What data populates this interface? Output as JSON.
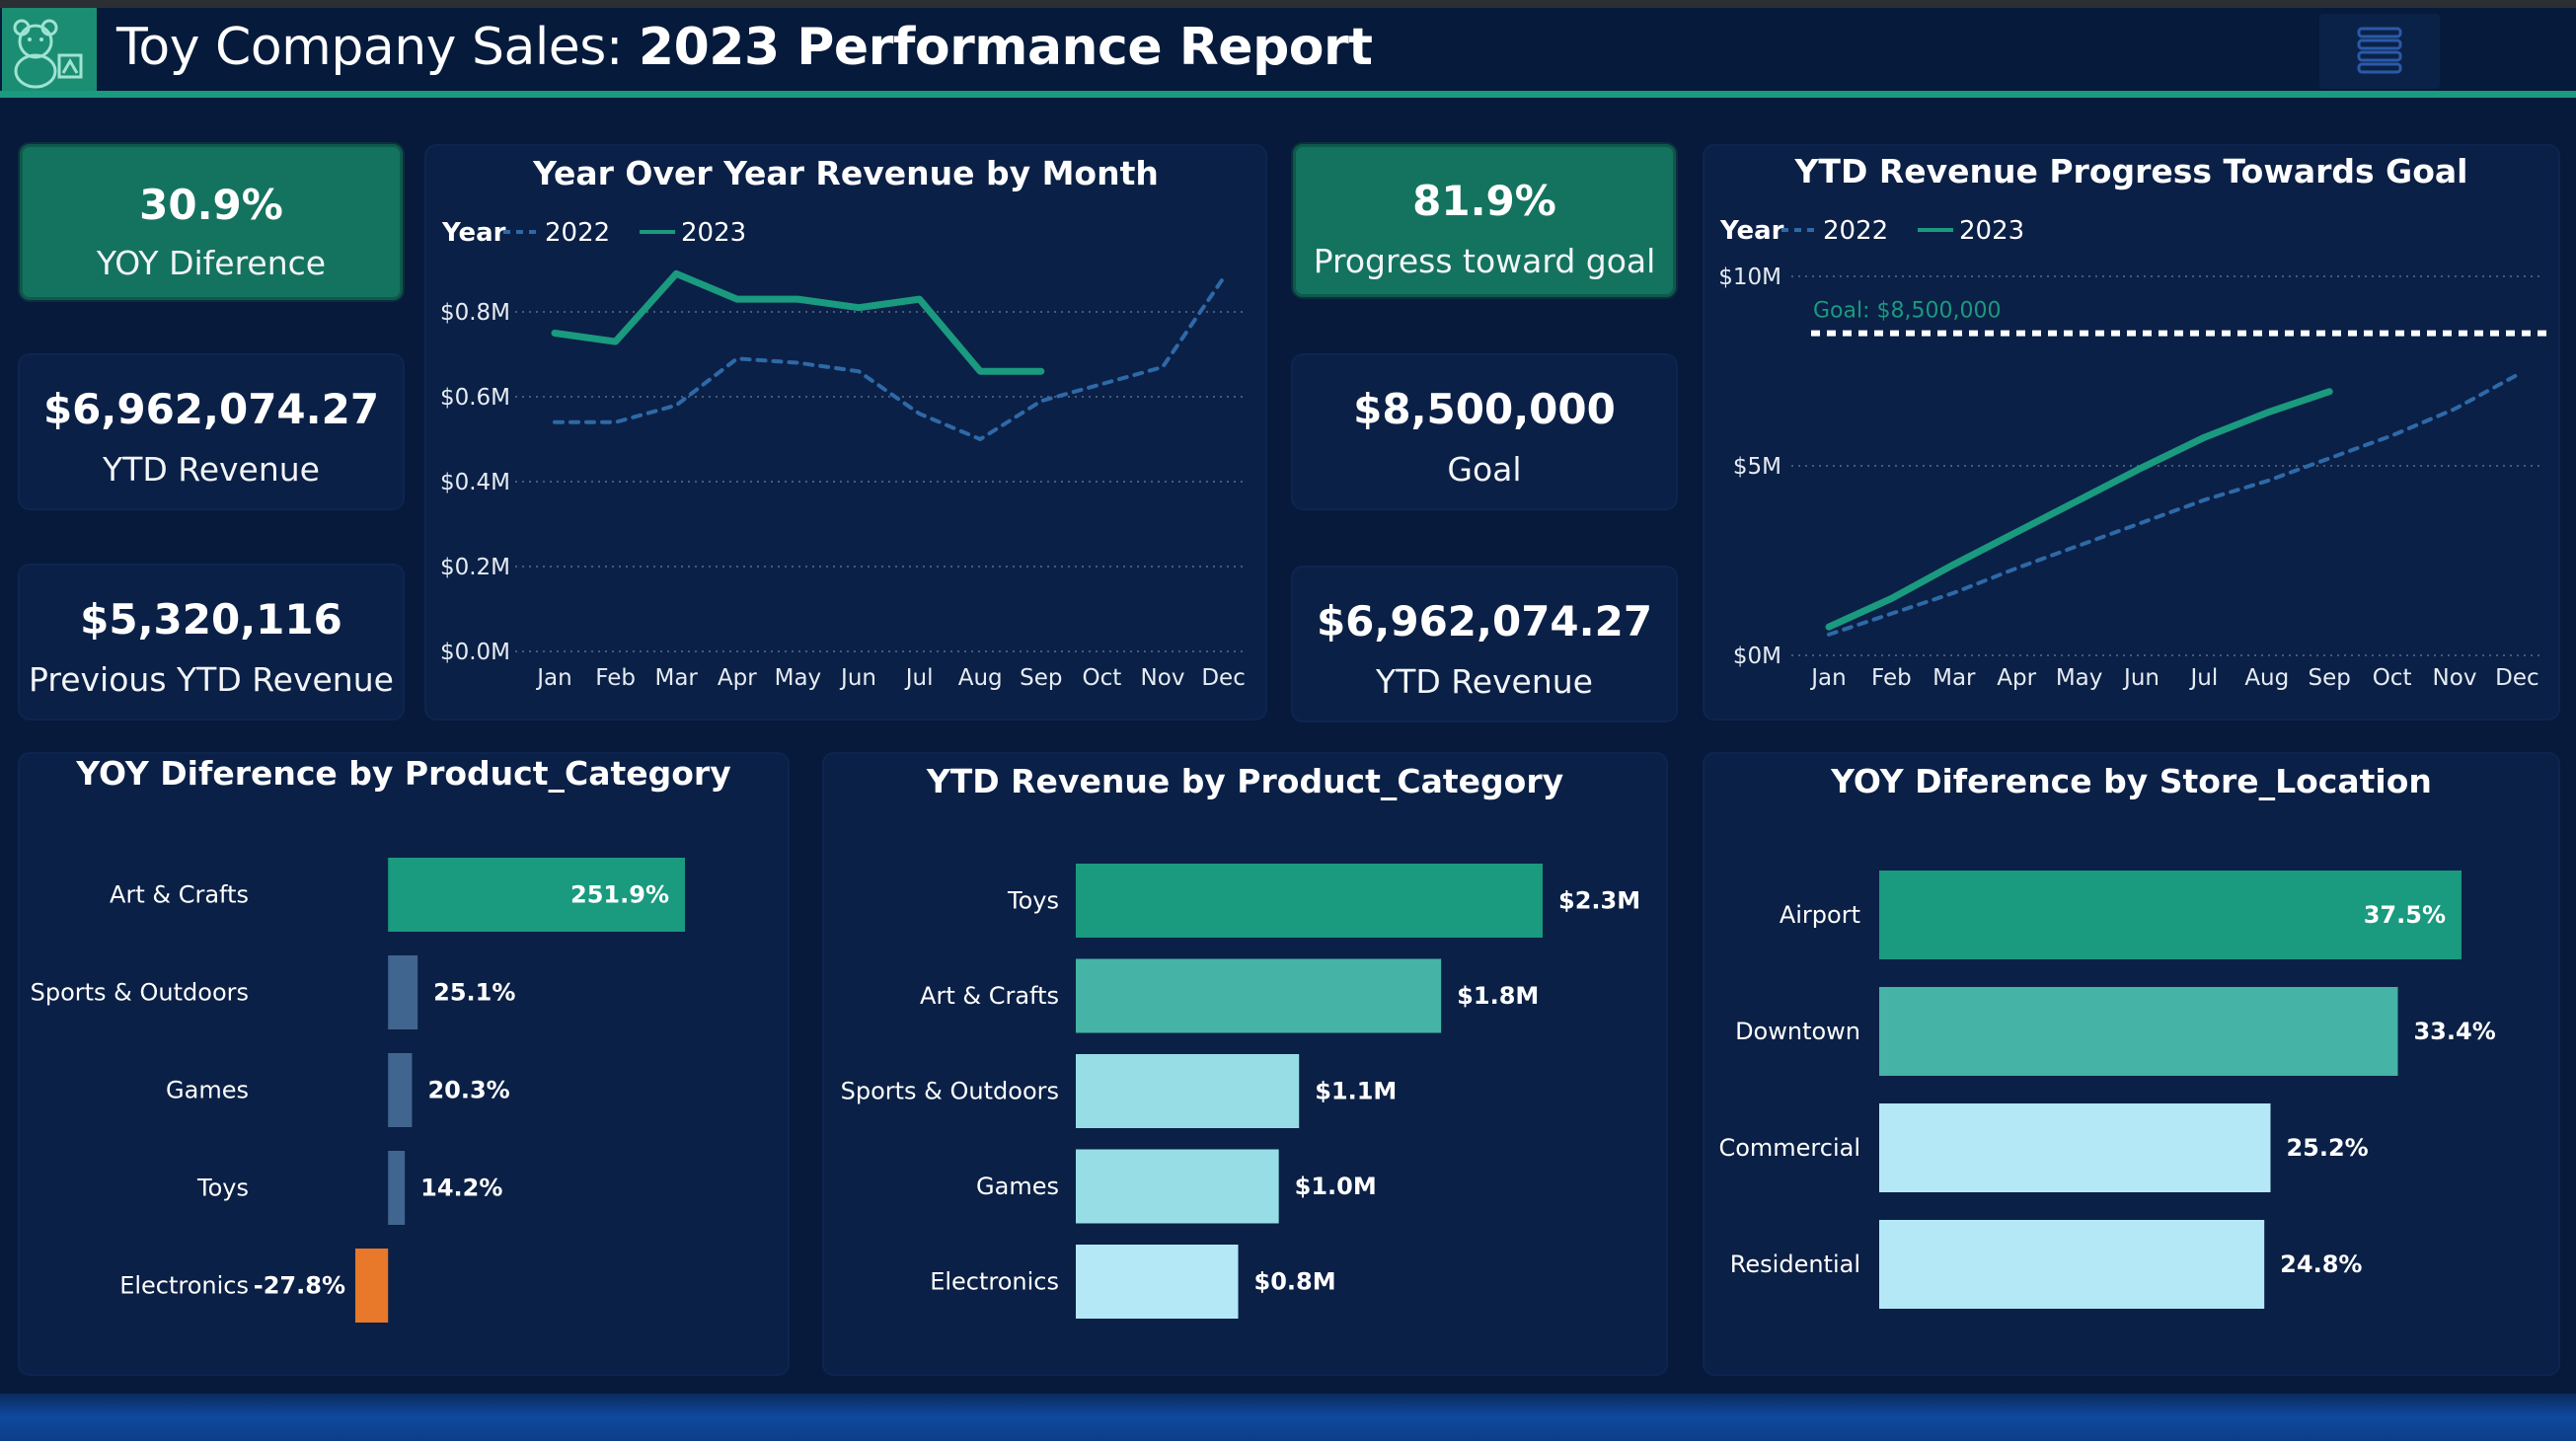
{
  "header": {
    "title_prefix": "Toy Company Sales: ",
    "title_bold": "2023 Performance Report",
    "logo_icon": "teddy-bear-icon",
    "menu_icon": "hamburger-menu-icon"
  },
  "colors": {
    "teal": "#1a9a7f",
    "teal_mid": "#45b3a5",
    "light_teal": "#97dde5",
    "lightest": "#b4e8f6",
    "slate": "#40658e",
    "orange": "#e8782a",
    "dashed_2022": "#2e69a8",
    "goal_line": "#ffffff",
    "goal_label": "#1a9a7f"
  },
  "kpis_left": [
    {
      "value": "30.9%",
      "label": "YOY Diference"
    },
    {
      "value": "$6,962,074.27",
      "label": "YTD Revenue"
    },
    {
      "value": "$5,320,116",
      "label": "Previous YTD Revenue"
    }
  ],
  "kpis_right": [
    {
      "value": "81.9%",
      "label": "Progress toward goal"
    },
    {
      "value": "$8,500,000",
      "label": "Goal"
    },
    {
      "value": "$6,962,074.27",
      "label": "YTD Revenue"
    }
  ],
  "chart_data": [
    {
      "type": "line",
      "title": "Year Over Year Revenue by Month",
      "legend_title": "Year",
      "legend_position": "top-left",
      "x": [
        "Jan",
        "Feb",
        "Mar",
        "Apr",
        "May",
        "Jun",
        "Jul",
        "Aug",
        "Sep",
        "Oct",
        "Nov",
        "Dec"
      ],
      "y_ticks": [
        "$0.0M",
        "$0.2M",
        "$0.4M",
        "$0.6M",
        "$0.8M"
      ],
      "ylim": [
        0,
        0.8
      ],
      "grid": true,
      "series": [
        {
          "name": "2022",
          "style": "dashed",
          "values": [
            0.54,
            0.54,
            0.58,
            0.69,
            0.68,
            0.66,
            0.56,
            0.5,
            0.59,
            0.63,
            0.67,
            0.88
          ]
        },
        {
          "name": "2023",
          "style": "solid",
          "values": [
            0.75,
            0.73,
            0.89,
            0.83,
            0.83,
            0.81,
            0.83,
            0.66,
            0.66,
            null,
            null,
            null
          ]
        }
      ]
    },
    {
      "type": "line",
      "title": "YTD Revenue Progress Towards Goal",
      "legend_title": "Year",
      "legend_position": "top-left",
      "x": [
        "Jan",
        "Feb",
        "Mar",
        "Apr",
        "May",
        "Jun",
        "Jul",
        "Aug",
        "Sep",
        "Oct",
        "Nov",
        "Dec"
      ],
      "y_ticks": [
        "$0M",
        "$5M",
        "$10M"
      ],
      "ylim": [
        0,
        10
      ],
      "grid": true,
      "goal": {
        "value": 8.5,
        "label": "Goal: $8,500,000"
      },
      "series": [
        {
          "name": "2022",
          "style": "dashed",
          "values": [
            0.55,
            1.1,
            1.65,
            2.3,
            2.9,
            3.5,
            4.1,
            4.6,
            5.2,
            5.8,
            6.5,
            7.4
          ]
        },
        {
          "name": "2023",
          "style": "solid",
          "values": [
            0.75,
            1.5,
            2.4,
            3.25,
            4.1,
            4.95,
            5.75,
            6.4,
            6.96,
            null,
            null,
            null
          ]
        }
      ]
    },
    {
      "type": "bar",
      "orientation": "horizontal",
      "title": "YOY Diference by Product_Category",
      "categories": [
        "Art & Crafts",
        "Sports & Outdoors",
        "Games",
        "Toys",
        "Electronics"
      ],
      "values": [
        251.9,
        25.1,
        20.3,
        14.2,
        -27.8
      ],
      "labels": [
        "251.9%",
        "25.1%",
        "20.3%",
        "14.2%",
        "-27.8%"
      ],
      "colors": [
        "#1a9a7f",
        "#40658e",
        "#40658e",
        "#40658e",
        "#e8782a"
      ],
      "xlim": [
        -27.8,
        251.9
      ]
    },
    {
      "type": "bar",
      "orientation": "horizontal",
      "title": "YTD Revenue by Product_Category",
      "categories": [
        "Toys",
        "Art & Crafts",
        "Sports & Outdoors",
        "Games",
        "Electronics"
      ],
      "values": [
        2.3,
        1.8,
        1.1,
        1.0,
        0.8
      ],
      "labels": [
        "$2.3M",
        "$1.8M",
        "$1.1M",
        "$1.0M",
        "$0.8M"
      ],
      "colors": [
        "#1a9a7f",
        "#45b3a5",
        "#97dde5",
        "#97dde5",
        "#b4e8f6"
      ],
      "xlim": [
        0,
        2.3
      ]
    },
    {
      "type": "bar",
      "orientation": "horizontal",
      "title": "YOY Diference by Store_Location",
      "categories": [
        "Airport",
        "Downtown",
        "Commercial",
        "Residential"
      ],
      "values": [
        37.5,
        33.4,
        25.2,
        24.8
      ],
      "labels": [
        "37.5%",
        "33.4%",
        "25.2%",
        "24.8%"
      ],
      "colors": [
        "#1a9a7f",
        "#45b3a5",
        "#b4e8f6",
        "#b4e8f6"
      ],
      "xlim": [
        0,
        37.5
      ]
    }
  ]
}
